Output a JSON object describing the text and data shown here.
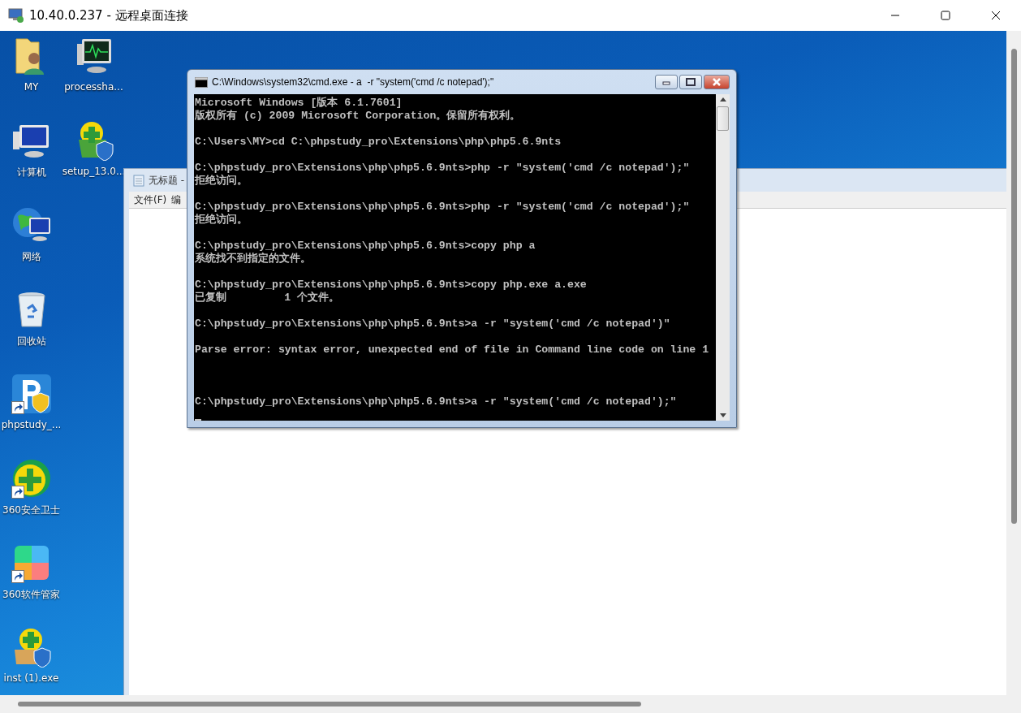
{
  "window": {
    "title": "10.40.0.237 - 远程桌面连接"
  },
  "desktop_icons": [
    {
      "label": "MY",
      "shortcut": false
    },
    {
      "label": "processha...",
      "shortcut": false
    },
    {
      "label": "计算机",
      "shortcut": false
    },
    {
      "label": "setup_13.0...",
      "shortcut": false
    },
    {
      "label": "网络",
      "shortcut": false
    },
    {
      "label": "回收站",
      "shortcut": false
    },
    {
      "label": "phpstudy_...",
      "shortcut": true
    },
    {
      "label": "360安全卫士",
      "shortcut": true
    },
    {
      "label": "360软件管家",
      "shortcut": true
    },
    {
      "label": "inst (1).exe",
      "shortcut": false
    }
  ],
  "notepad": {
    "title": "无标题 -",
    "menu": [
      "文件(F)",
      "编"
    ]
  },
  "cmd": {
    "title": "C:\\Windows\\system32\\cmd.exe - a  -r \"system('cmd /c notepad');\"",
    "blocks": [
      {
        "lines": [
          "Microsoft Windows [版本 6.1.7601]",
          "版权所有 (c) 2009 Microsoft Corporation。保留所有权利。"
        ]
      },
      {
        "lines": [
          "C:\\Users\\MY>cd C:\\phpstudy_pro\\Extensions\\php\\php5.6.9nts"
        ],
        "extra_gap": false
      },
      {
        "lines": [
          "C:\\phpstudy_pro\\Extensions\\php\\php5.6.9nts>php -r \"system('cmd /c notepad');\"",
          "拒绝访问。"
        ],
        "extra_gap": false
      },
      {
        "lines": [
          "C:\\phpstudy_pro\\Extensions\\php\\php5.6.9nts>php -r \"system('cmd /c notepad');\"",
          "拒绝访问。"
        ],
        "extra_gap": false
      },
      {
        "lines": [
          "C:\\phpstudy_pro\\Extensions\\php\\php5.6.9nts>copy php a",
          "系统找不到指定的文件。"
        ],
        "extra_gap": false
      },
      {
        "lines": [
          "C:\\phpstudy_pro\\Extensions\\php\\php5.6.9nts>copy php.exe a.exe",
          "已复制         1 个文件。"
        ],
        "extra_gap": false
      },
      {
        "lines": [
          "C:\\phpstudy_pro\\Extensions\\php\\php5.6.9nts>a -r \"system('cmd /c notepad')\""
        ],
        "extra_gap": false
      },
      {
        "lines": [
          "Parse error: syntax error, unexpected end of file in Command line code on line 1"
        ],
        "extra_gap": false
      },
      {
        "lines": [
          "C:\\phpstudy_pro\\Extensions\\php\\php5.6.9nts>a -r \"system('cmd /c notepad');\""
        ],
        "extra_gap": true
      }
    ]
  }
}
